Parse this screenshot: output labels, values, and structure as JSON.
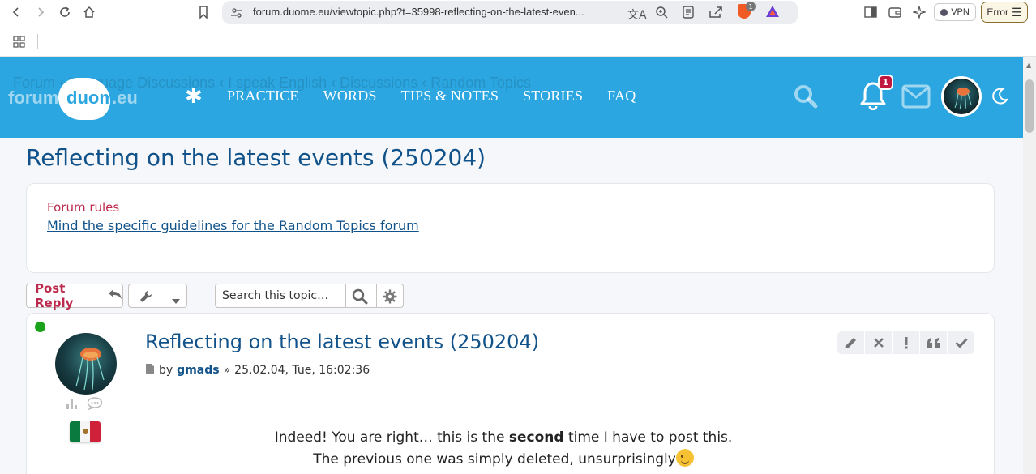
{
  "browser": {
    "url": "forum.duome.eu/viewtopic.php?t=35998-reflecting-on-the-latest-even...",
    "vpn_label": "VPN",
    "error_label": "Error",
    "brave_badge": "1"
  },
  "header": {
    "breadcrumbs": "Forum  ‹  Language Discussions  ‹  I speak English  ‹  Discussions  ‹  Random Topics",
    "logo": {
      "part1": "forum",
      "part2": "duome",
      "part3": ".eu"
    },
    "nav": [
      "PRACTICE",
      "WORDS",
      "TIPS & NOTES",
      "STORIES",
      "FAQ"
    ],
    "notification_count": "1"
  },
  "page": {
    "title": "Reflecting on the latest events (250204)"
  },
  "rules": {
    "title": "Forum rules",
    "link": "Mind the specific guidelines for the Random Topics forum"
  },
  "actions": {
    "post_reply_label": "Post Reply",
    "search_placeholder": "Search this topic…"
  },
  "post": {
    "title": "Reflecting on the latest events (250204)",
    "by": "by",
    "author": "gmads",
    "sep": "»",
    "date": "25.02.04, Tue, 16:02:36",
    "body_line1_a": "Indeed! You are right… this is the ",
    "body_line1_bold": "second",
    "body_line1_b": " time I have to post this.",
    "body_line2": "The previous one was simply deleted, unsurprisingly"
  },
  "colors": {
    "header_bg": "#2ba6e0",
    "title_blue": "#105289",
    "accent_red": "#bc2a4d",
    "online_green": "#1aa31a"
  }
}
